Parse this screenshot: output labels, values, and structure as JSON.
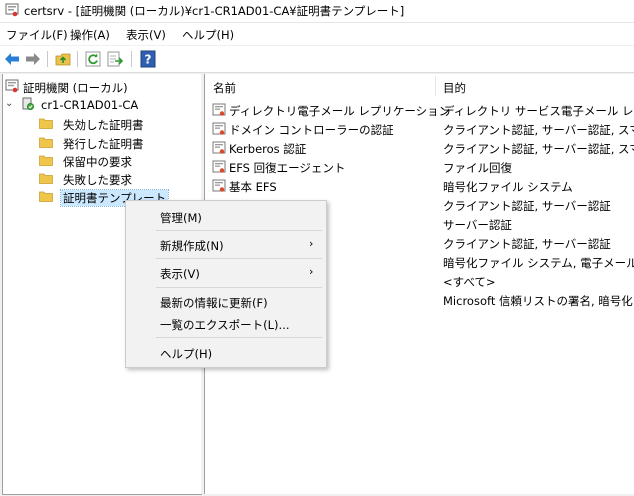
{
  "window": {
    "title": "certsrv - [証明機関 (ローカル)¥cr1-CR1AD01-CA¥証明書テンプレート]"
  },
  "menubar": {
    "items": [
      "ファイル(F)",
      "操作(A)",
      "表示(V)",
      "ヘルプ(H)"
    ]
  },
  "toolbar": {
    "icons": [
      "back-arrow-icon",
      "forward-arrow-icon",
      "up-folder-icon",
      "refresh-icon",
      "export-icon",
      "help-icon"
    ],
    "help_glyph": "?"
  },
  "tree": {
    "root": "証明機関 (ローカル)",
    "ca": "cr1-CR1AD01-CA",
    "children": [
      "失効した証明書",
      "発行した証明書",
      "保留中の要求",
      "失敗した要求",
      "証明書テンプレート"
    ]
  },
  "list": {
    "headers": {
      "name": "名前",
      "purpose": "目的"
    },
    "rows": [
      {
        "name": "ディレクトリ電子メール レプリケーション",
        "purpose": "ディレクトリ サービス電子メール レプリケーション"
      },
      {
        "name": "ドメイン コントローラーの認証",
        "purpose": "クライアント認証, サーバー認証, スマート カード ログオン"
      },
      {
        "name": "Kerberos 認証",
        "purpose": "クライアント認証, サーバー認証, スマート カード ログオン"
      },
      {
        "name": "EFS 回復エージェント",
        "purpose": "ファイル回復"
      },
      {
        "name": "基本 EFS",
        "purpose": "暗号化ファイル システム"
      },
      {
        "name": "",
        "purpose": "クライアント認証, サーバー認証"
      },
      {
        "name": "",
        "purpose": "サーバー認証"
      },
      {
        "name": "",
        "purpose": "クライアント認証, サーバー認証"
      },
      {
        "name": "",
        "purpose": "暗号化ファイル システム, 電子メールの保護, クライアント認証"
      },
      {
        "name": "",
        "purpose": "<すべて>"
      },
      {
        "name": "",
        "purpose": "Microsoft 信頼リストの署名, 暗号化ファイル システム"
      }
    ]
  },
  "context_menu": {
    "items": [
      {
        "label": "管理(M)",
        "submenu": false
      },
      {
        "label": "新規作成(N)",
        "submenu": true
      },
      {
        "label": "表示(V)",
        "submenu": true
      },
      {
        "label": "最新の情報に更新(F)",
        "submenu": false
      },
      {
        "label": "一覧のエクスポート(L)...",
        "submenu": false
      },
      {
        "label": "ヘルプ(H)",
        "submenu": false
      }
    ],
    "submenu_glyph": "›"
  },
  "colors": {
    "selection": "#cce8ff",
    "folder": "#f0c64a",
    "accent_blue": "#1f7bd1"
  }
}
